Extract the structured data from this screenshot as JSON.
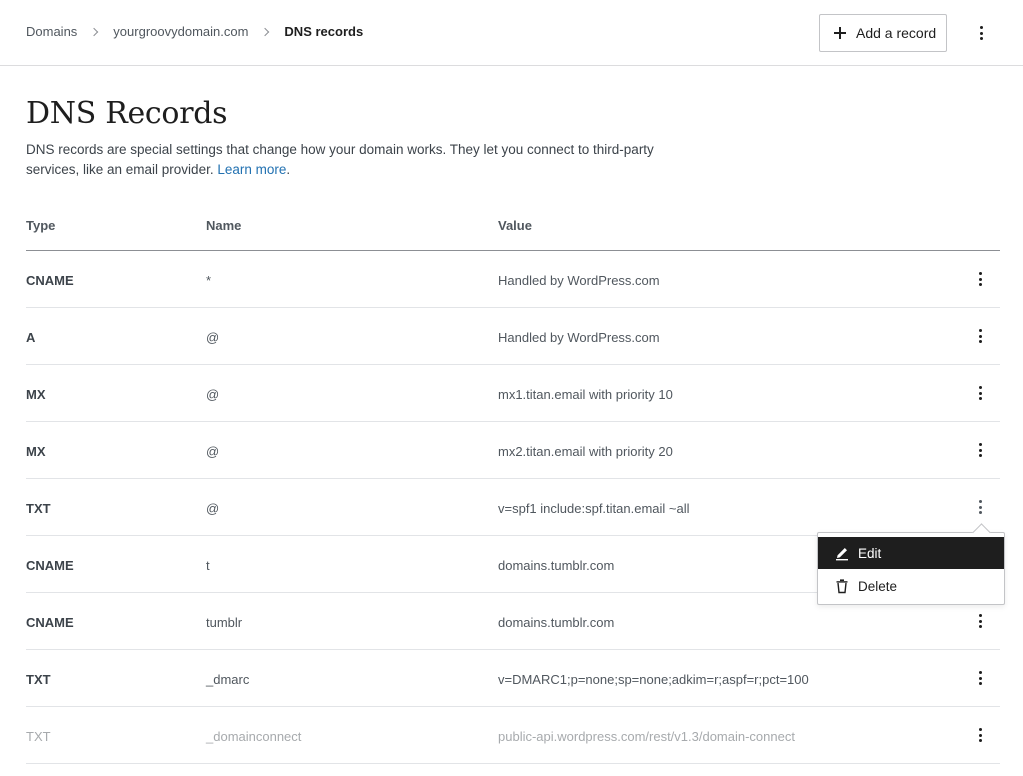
{
  "breadcrumb": {
    "items": [
      "Domains",
      "yourgroovydomain.com",
      "DNS records"
    ]
  },
  "header": {
    "add_record_label": "Add a record"
  },
  "page": {
    "title": "DNS Records",
    "description": "DNS records are special settings that change how your domain works. They let you connect to third-party services, like an email provider.",
    "learn_more": "Learn more",
    "trailing_period": "."
  },
  "table": {
    "headers": [
      "Type",
      "Name",
      "Value"
    ],
    "rows": [
      {
        "type": "CNAME",
        "name": "*",
        "value": "Handled by WordPress.com"
      },
      {
        "type": "A",
        "name": "@",
        "value": "Handled by WordPress.com"
      },
      {
        "type": "MX",
        "name": "@",
        "value": "mx1.titan.email with priority 10"
      },
      {
        "type": "MX",
        "name": "@",
        "value": "mx2.titan.email with priority 20"
      },
      {
        "type": "TXT",
        "name": "@",
        "value": "v=spf1 include:spf.titan.email ~all"
      },
      {
        "type": "CNAME",
        "name": "t",
        "value": "domains.tumblr.com"
      },
      {
        "type": "CNAME",
        "name": "tumblr",
        "value": "domains.tumblr.com"
      },
      {
        "type": "TXT",
        "name": "_dmarc",
        "value": "v=DMARC1;p=none;sp=none;adkim=r;aspf=r;pct=100"
      },
      {
        "type": "TXT",
        "name": "_domainconnect",
        "value": "public-api.wordpress.com/rest/v1.3/domain-connect"
      }
    ]
  },
  "context_menu": {
    "edit_label": "Edit",
    "delete_label": "Delete"
  },
  "icons": {
    "add": "plus-icon",
    "more": "vertical-ellipsis-icon",
    "edit": "pencil-icon",
    "delete": "trash-icon"
  },
  "colors": {
    "link": "#2271b1",
    "menu_active_bg": "#1e1e1e",
    "text_primary": "#1e1e1e",
    "text_muted": "#a7aaad"
  }
}
